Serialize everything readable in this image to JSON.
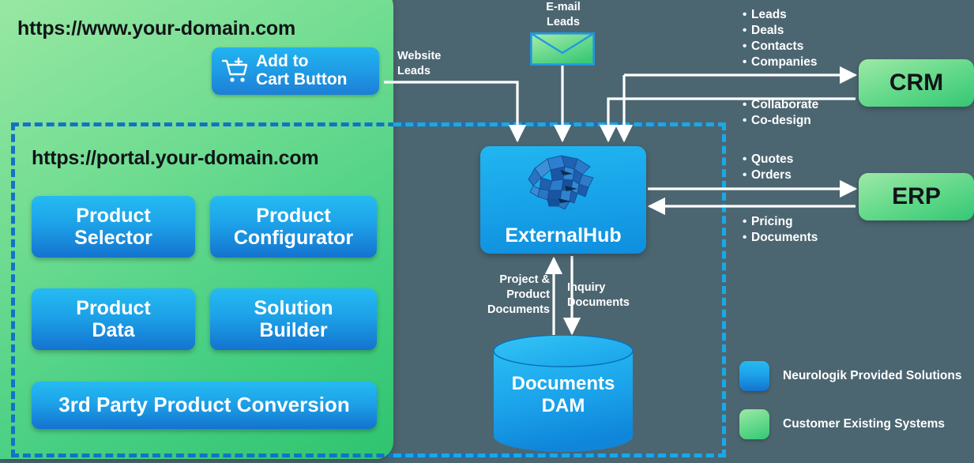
{
  "background_color": "#4c6671",
  "website": {
    "url": "https://www.your-domain.com",
    "cart_button": {
      "line1": "Add to",
      "line2": "Cart Button",
      "icon": "add-to-cart-icon"
    }
  },
  "portal": {
    "url": "https://portal.your-domain.com",
    "cards": [
      {
        "label": "Product\nSelector"
      },
      {
        "label": "Product\nConfigurator"
      },
      {
        "label": "Product\nData"
      },
      {
        "label": "Solution\nBuilder"
      },
      {
        "label": "3rd Party Product Conversion"
      }
    ]
  },
  "hub": {
    "label": "ExternalHub",
    "icon": "brain-icon"
  },
  "storage": {
    "label": "Documents\nDAM",
    "icon": "database-cylinder-icon"
  },
  "email": {
    "label": "E-mail\nLeads",
    "icon": "envelope-icon"
  },
  "flow_labels": {
    "website_leads": "Website\nLeads",
    "project_product_documents": "Project &\nProduct\nDocuments",
    "inquiry_documents": "Inquiry\nDocuments"
  },
  "crm": {
    "label": "CRM",
    "inbound_items": [
      "Leads",
      "Deals",
      "Contacts",
      "Companies"
    ],
    "outbound_items": [
      "Collaborate",
      "Co-design"
    ]
  },
  "erp": {
    "label": "ERP",
    "inbound_items": [
      "Quotes",
      "Orders"
    ],
    "outbound_items": [
      "Pricing",
      "Documents"
    ]
  },
  "legend": {
    "items": [
      {
        "label": "Neurologik Provided Solutions",
        "color": "#1da2e8"
      },
      {
        "label": "Customer Existing Systems",
        "color": "#6bdb8e"
      }
    ]
  }
}
